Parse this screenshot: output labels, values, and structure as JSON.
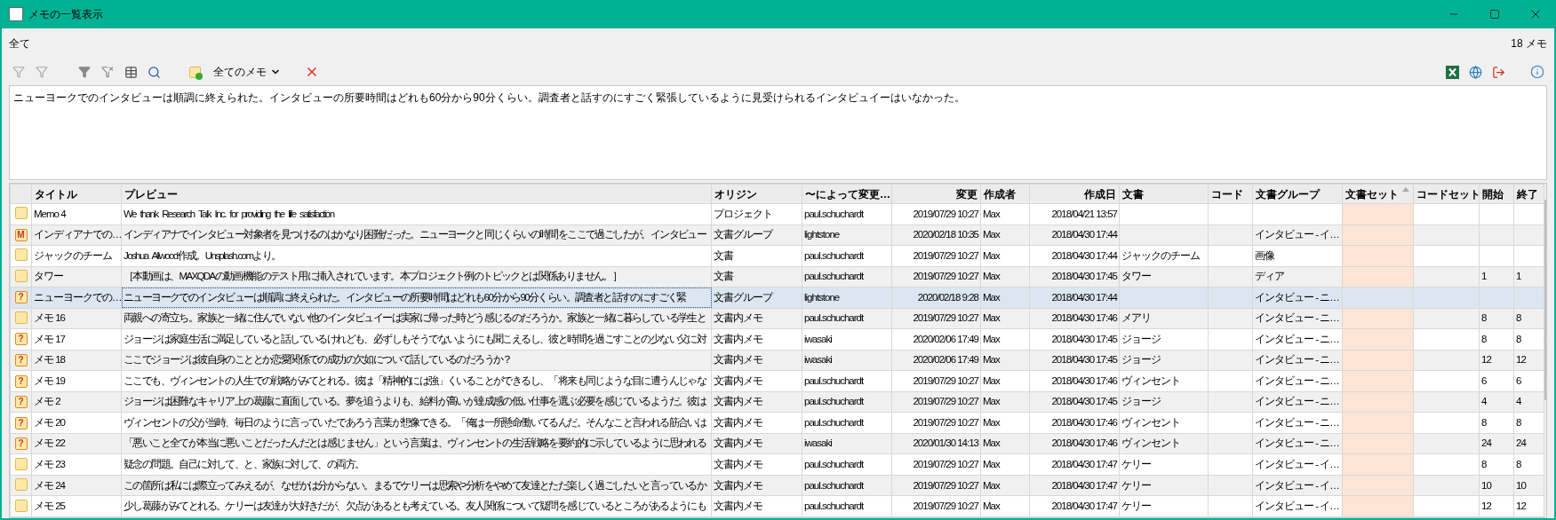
{
  "window": {
    "title": "メモの一覧表示"
  },
  "filter_label": "全て",
  "memo_count": "18 メモ",
  "toolbar": {
    "dropdown": "全てのメモ"
  },
  "memo_text": "ニューヨークでのインタビューは順調に終えられた。インタビューの所要時間はどれも60分から90分くらい。調査者と話すのにすごく緊張しているように見受けられるインタビュイーはいなかった。",
  "table": {
    "columns": [
      {
        "sorted": false
      },
      {
        "label": "タイトル",
        "sorted": false
      },
      {
        "label": "プレビュー",
        "sorted": false
      },
      {
        "label": "オリジン",
        "sorted": false
      },
      {
        "label": "〜によって変更…",
        "sorted": false
      },
      {
        "label": "変更",
        "sorted": false
      },
      {
        "label": "作成者",
        "sorted": false
      },
      {
        "label": "作成日",
        "sorted": false
      },
      {
        "label": "文書",
        "sorted": false
      },
      {
        "label": "コード",
        "sorted": false
      },
      {
        "label": "文書グループ",
        "sorted": false
      },
      {
        "label": "文書セット",
        "sorted": true
      },
      {
        "label": "コードセット",
        "sorted": false
      },
      {
        "label": "開始",
        "sorted": false
      },
      {
        "label": "終了",
        "sorted": false
      }
    ],
    "rows": [
      {
        "icon": {
          "kind": "plain"
        },
        "selected": false,
        "title": "Memo 4",
        "preview": "We thank Research Talk Inc. for providing the life satisfaction",
        "origin": "プロジェクト",
        "modified_by": "paul.schuchardt",
        "modified": "2019/07/29 10:27",
        "author": "Max",
        "created": "2018/04/21 13:57"
      },
      {
        "icon": {
          "kind": "labeled",
          "label": "M"
        },
        "selected": false,
        "title": "インディアナでの…",
        "preview": "インディアナでインタビュー対象者を見つけるのはかなり困難だった。ニューヨークと同じくらいの時間をここで過ごしたが。インタビュー",
        "origin": "文書グループ",
        "modified_by": "lightstone",
        "modified": "2020/02/18 10:35",
        "author": "Max",
        "created": "2018/04/30 17:44",
        "document_group": "インタビュー - イ…"
      },
      {
        "icon": {
          "kind": "plain"
        },
        "selected": false,
        "title": "ジャックのチーム",
        "preview": "Joshua Allwood作成。Unsplash.comより。",
        "origin": "文書",
        "modified_by": "paul.schuchardt",
        "modified": "2019/07/29 10:27",
        "author": "Max",
        "created": "2018/04/30 17:44",
        "document": "ジャックのチーム",
        "document_group": "画像"
      },
      {
        "icon": {
          "kind": "plain"
        },
        "selected": false,
        "title": "タワー",
        "preview": "［本動画は、MAXQDAの動画機能のテスト用に挿入されています。本プロジェクト例のトピックとは関係ありません。］",
        "origin": "文書",
        "modified_by": "paul.schuchardt",
        "modified": "2019/07/29 10:27",
        "author": "Max",
        "created": "2018/04/30 17:45",
        "document": "タワー",
        "document_group": "ディア",
        "start": "1",
        "end": "1"
      },
      {
        "icon": {
          "kind": "labeled",
          "label": "?"
        },
        "selected": true,
        "title": "ニューヨークでの…",
        "preview": "ニューヨークでのインタビューは順調に終えられた。インタビューの所要時間はどれも60分から90分くらい。調査者と話すのにすごく緊",
        "origin": "文書グループ",
        "modified_by": "lightstone",
        "modified": "2020/02/18 9:28",
        "author": "Max",
        "created": "2018/04/30 17:44",
        "document_group": "インタビュー - ニ…"
      },
      {
        "icon": {
          "kind": "plain"
        },
        "selected": false,
        "title": "メモ 16",
        "preview": "両親への寄立ち。家族と一緒に住んでいない他のインタビュイーは実家に帰った時どう感じるのだろうか。家族と一緒に暮らしている学生と",
        "origin": "文書内メモ",
        "modified_by": "paul.schuchardt",
        "modified": "2019/07/29 10:27",
        "author": "Max",
        "created": "2018/04/30 17:46",
        "document": "メアリ",
        "document_group": "インタビュー - ニ…",
        "start": "8",
        "end": "8"
      },
      {
        "icon": {
          "kind": "labeled",
          "label": "?"
        },
        "selected": false,
        "title": "メモ 17",
        "preview": "ジョージは家庭生活に満足していると話しているけれども、必ずしもそうでないようにも聞こえるし、彼と時間を過ごすことの少ない父に対",
        "origin": "文書内メモ",
        "modified_by": "iwasaki",
        "modified": "2020/02/06 17:49",
        "author": "Max",
        "created": "2018/04/30 17:45",
        "document": "ジョージ",
        "document_group": "インタビュー - ニ…",
        "start": "8",
        "end": "8"
      },
      {
        "icon": {
          "kind": "labeled",
          "label": "?"
        },
        "selected": false,
        "title": "メモ 18",
        "preview": "ここでジョージは彼自身のこととか恋愛関係での成功の欠如について話しているのだろうか？",
        "origin": "文書内メモ",
        "modified_by": "iwasaki",
        "modified": "2020/02/06 17:49",
        "author": "Max",
        "created": "2018/04/30 17:45",
        "document": "ジョージ",
        "document_group": "インタビュー - ニ…",
        "start": "12",
        "end": "12"
      },
      {
        "icon": {
          "kind": "labeled",
          "label": "?"
        },
        "selected": false,
        "title": "メモ 19",
        "preview": "ここでも、ヴィンセントの人生での戦略がみてとれる。彼は「精神的には強」くいることができるし、「将来も同じような目に遭うんじゃな",
        "origin": "文書内メモ",
        "modified_by": "paul.schuchardt",
        "modified": "2019/07/29 10:27",
        "author": "Max",
        "created": "2018/04/30 17:46",
        "document": "ヴィンセント",
        "document_group": "インタビュー - ニ…",
        "start": "6",
        "end": "6"
      },
      {
        "icon": {
          "kind": "labeled",
          "label": "?"
        },
        "selected": false,
        "title": "メモ 2",
        "preview": "ジョージは困難なキャリア上の葛藤に直面している。夢を追うよりも、給料が高いが達成感の低い仕事を選ぶ必要を感じているようだ。彼は",
        "origin": "文書内メモ",
        "modified_by": "paul.schuchardt",
        "modified": "2019/07/29 10:27",
        "author": "Max",
        "created": "2018/04/30 17:45",
        "document": "ジョージ",
        "document_group": "インタビュー - ニ…",
        "start": "4",
        "end": "4"
      },
      {
        "icon": {
          "kind": "labeled",
          "label": "?"
        },
        "selected": false,
        "title": "メモ 20",
        "preview": "ヴィンセントの父が当時、毎日のように言っていたであろう言葉が想像できる。「俺は一所懸命働いてるんだ。そんなこと言われる筋合いは",
        "origin": "文書内メモ",
        "modified_by": "paul.schuchardt",
        "modified": "2019/07/29 10:27",
        "author": "Max",
        "created": "2018/04/30 17:46",
        "document": "ヴィンセント",
        "document_group": "インタビュー - ニ…",
        "start": "8",
        "end": "8"
      },
      {
        "icon": {
          "kind": "labeled",
          "label": "?"
        },
        "selected": false,
        "title": "メモ 22",
        "preview": "「悪いこと全てが本当に悪いことだったんだとは感じません」という言葉は、ヴィンセントの生活戦略を要約的に示しているように思われる",
        "origin": "文書内メモ",
        "modified_by": "iwasaki",
        "modified": "2020/01/30 14:13",
        "author": "Max",
        "created": "2018/04/30 17:46",
        "document": "ヴィンセント",
        "document_group": "インタビュー - ニ…",
        "start": "24",
        "end": "24"
      },
      {
        "icon": {
          "kind": "plain"
        },
        "selected": false,
        "title": "メモ 23",
        "preview": "疑念の問題。自己に対して、と、家族に対して、の両方。",
        "origin": "文書内メモ",
        "modified_by": "paul.schuchardt",
        "modified": "2019/07/29 10:27",
        "author": "Max",
        "created": "2018/04/30 17:47",
        "document": "ケリー",
        "document_group": "インタビュー - イ…",
        "start": "8",
        "end": "8"
      },
      {
        "icon": {
          "kind": "plain"
        },
        "selected": false,
        "title": "メモ 24",
        "preview": "この箇所は私には際立ってみえるが、なぜかは分からない。まるでケリーは思索や分析をやめて友達とただ楽しく過ごしたいと言っているか",
        "origin": "文書内メモ",
        "modified_by": "paul.schuchardt",
        "modified": "2019/07/29 10:27",
        "author": "Max",
        "created": "2018/04/30 17:47",
        "document": "ケリー",
        "document_group": "インタビュー - イ…",
        "start": "10",
        "end": "10"
      },
      {
        "icon": {
          "kind": "plain"
        },
        "selected": false,
        "title": "メモ 25",
        "preview": "少し葛藤がみてとれる。ケリーは友達が大好きだが、欠点があるとも考えている。友人関係について疑問を感じているところがあるようにも",
        "origin": "文書内メモ",
        "modified_by": "paul.schuchardt",
        "modified": "2019/07/29 10:27",
        "author": "Max",
        "created": "2018/04/30 17:47",
        "document": "ケリー",
        "document_group": "インタビュー - イ…",
        "start": "12",
        "end": "12"
      }
    ]
  }
}
